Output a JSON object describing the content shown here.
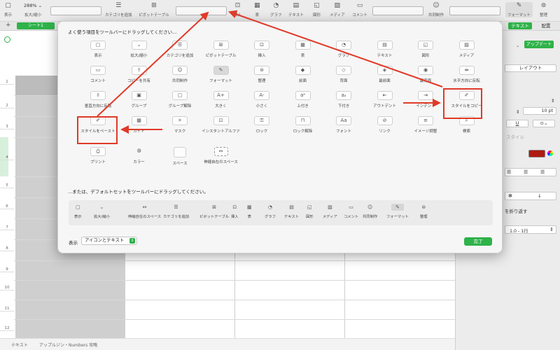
{
  "toolbar": {
    "view": {
      "label": "表示",
      "icon": "sidebar-icon"
    },
    "zoom": {
      "value": "288% ⌄",
      "label": "拡大/縮小"
    },
    "category": {
      "label": "カテゴリを追加",
      "icon": "list-icon"
    },
    "pivot": {
      "label": "ピボットテーブル",
      "icon": "pivot-icon"
    },
    "insert": {
      "label": "挿入",
      "icon": "insert-icon"
    },
    "table": {
      "label": "表",
      "icon": "table-icon"
    },
    "chart": {
      "label": "グラフ",
      "icon": "chart-icon"
    },
    "text": {
      "label": "テキスト",
      "icon": "text-icon"
    },
    "shape": {
      "label": "図形",
      "icon": "shape-icon"
    },
    "media": {
      "label": "メディア",
      "icon": "media-icon"
    },
    "comment": {
      "label": "コメント",
      "icon": "comment-icon"
    },
    "collab": {
      "label": "共同制作",
      "icon": "collab-icon"
    },
    "format": {
      "label": "フォーマット",
      "icon": "brush-icon"
    },
    "organize": {
      "label": "整理",
      "icon": "organize-icon"
    }
  },
  "tabs": {
    "sheet1": "シート1",
    "text_tab": "テキスト",
    "arrange_tab": "配置"
  },
  "rows": [
    "1",
    "2",
    "3",
    "4",
    "5",
    "6",
    "7",
    "8",
    "9",
    "10",
    "11",
    "12"
  ],
  "inspector": {
    "update_btn": "アップデート",
    "layout_tab": "レイアウト",
    "font_size": "10 pt",
    "underline": "U",
    "style_hint": "スタイル",
    "wrap_label": "を折り返す",
    "line_spacing": "1.0 - 1行"
  },
  "status": {
    "left": "テキスト",
    "doc": "アップルジン・Numbers 攻略"
  },
  "dialog": {
    "title": "よく使う項目をツールバーにドラッグしてください...",
    "items": [
      {
        "label": "表示",
        "icon": "sidebar-icon"
      },
      {
        "label": "拡大/縮小",
        "icon": "zoom-icon"
      },
      {
        "label": "カテゴリを追加",
        "icon": "list-icon"
      },
      {
        "label": "ピボットテーブル",
        "icon": "pivot-icon"
      },
      {
        "label": "挿入",
        "icon": "insert-icon"
      },
      {
        "label": "表",
        "icon": "table-icon"
      },
      {
        "label": "グラフ",
        "icon": "chart-icon"
      },
      {
        "label": "テキスト",
        "icon": "text-icon"
      },
      {
        "label": "図形",
        "icon": "shape-icon"
      },
      {
        "label": "メディア",
        "icon": "media-icon"
      },
      {
        "label": "コメント",
        "icon": "comment-icon"
      },
      {
        "label": "コピーを共有",
        "icon": "share-icon"
      },
      {
        "label": "共同制作",
        "icon": "collab-icon"
      },
      {
        "label": "フォーマット",
        "icon": "brush-icon"
      },
      {
        "label": "整理",
        "icon": "organize-icon"
      },
      {
        "label": "前面",
        "icon": "front-icon"
      },
      {
        "label": "背面",
        "icon": "back-icon"
      },
      {
        "label": "最前面",
        "icon": "frontmost-icon"
      },
      {
        "label": "最背面",
        "icon": "backmost-icon"
      },
      {
        "label": "水平方向に反転",
        "icon": "flip-h-icon"
      },
      {
        "label": "垂直方向に反転",
        "icon": "flip-v-icon"
      },
      {
        "label": "グループ",
        "icon": "group-icon"
      },
      {
        "label": "グループ解除",
        "icon": "ungroup-icon"
      },
      {
        "label": "大きく",
        "icon": "font-bigger-icon"
      },
      {
        "label": "小さく",
        "icon": "font-smaller-icon"
      },
      {
        "label": "上付き",
        "icon": "superscript-icon"
      },
      {
        "label": "下付き",
        "icon": "subscript-icon"
      },
      {
        "label": "アウトデント",
        "icon": "outdent-icon"
      },
      {
        "label": "インデント",
        "icon": "indent-icon"
      },
      {
        "label": "スタイルをコピー",
        "icon": "copy-style-icon"
      },
      {
        "label": "スタイルをペースト",
        "icon": "paste-style-icon"
      },
      {
        "label": "ガイド",
        "icon": "guide-icon"
      },
      {
        "label": "マスク",
        "icon": "mask-icon"
      },
      {
        "label": "インスタントアルファ",
        "icon": "alpha-icon"
      },
      {
        "label": "ロック",
        "icon": "lock-icon"
      },
      {
        "label": "ロック解除",
        "icon": "unlock-icon"
      },
      {
        "label": "フォント",
        "icon": "font-icon"
      },
      {
        "label": "リンク",
        "icon": "link-icon"
      },
      {
        "label": "イメージ調整",
        "icon": "adjust-icon"
      },
      {
        "label": "検索",
        "icon": "search-icon"
      },
      {
        "label": "プリント",
        "icon": "print-icon"
      },
      {
        "label": "カラー",
        "icon": "color-icon"
      },
      {
        "label": "スペース",
        "icon": "space-icon"
      },
      {
        "label": "伸縮自在のスペース",
        "icon": "flex-space-icon"
      }
    ],
    "default_title": "...または、デフォルトセットをツールバーにドラッグしてください。",
    "default_items": [
      {
        "label": "表示",
        "icon": "sidebar-icon"
      },
      {
        "label": "拡大/縮小",
        "icon": "zoom-icon"
      },
      {
        "label": "伸縮自在のスペース",
        "icon": "flex-space-icon"
      },
      {
        "label": "カテゴリを追加",
        "icon": "list-icon"
      },
      {
        "label": "ピボットテーブル",
        "icon": "pivot-icon"
      },
      {
        "label": "挿入",
        "icon": "insert-icon"
      },
      {
        "label": "表",
        "icon": "table-icon"
      },
      {
        "label": "グラフ",
        "icon": "chart-icon"
      },
      {
        "label": "テキスト",
        "icon": "text-icon"
      },
      {
        "label": "図形",
        "icon": "shape-icon"
      },
      {
        "label": "メディア",
        "icon": "media-icon"
      },
      {
        "label": "コメント",
        "icon": "comment-icon"
      },
      {
        "label": "共同制作",
        "icon": "collab-icon"
      },
      {
        "label": "フォーマット",
        "icon": "brush-icon"
      },
      {
        "label": "整理",
        "icon": "organize-icon"
      }
    ],
    "show_label": "表示",
    "show_value": "アイコンとテキスト",
    "done": "完了"
  },
  "colors": {
    "accent": "#2fb24a",
    "annotation": "#e03a28"
  }
}
